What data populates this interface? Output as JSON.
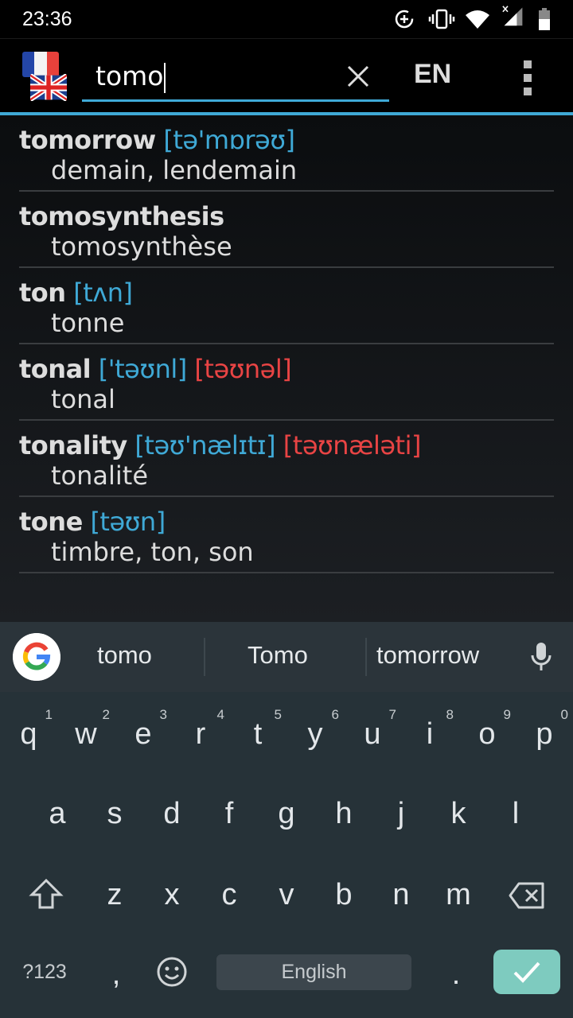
{
  "status_bar": {
    "time": "23:36",
    "icons": [
      "data-saver-icon",
      "vibrate-icon",
      "wifi-icon",
      "signal-no-data-icon",
      "battery-icon"
    ]
  },
  "app_bar": {
    "source_flag": "france-flag-icon",
    "target_flag": "uk-flag-icon",
    "search_value": "tomo",
    "clear_icon": "close-icon",
    "language_label": "EN",
    "menu_icon": "more-vert-icon",
    "accent_color": "#3fa9d6"
  },
  "results": [
    {
      "word": "tomorrow",
      "pron": "[tə'mɒrəʊ]",
      "pron_alt": "",
      "translation": "demain, lendemain"
    },
    {
      "word": "tomosynthesis",
      "pron": "",
      "pron_alt": "",
      "translation": "tomosynthèse"
    },
    {
      "word": "ton",
      "pron": "[tʌn]",
      "pron_alt": "",
      "translation": "tonne"
    },
    {
      "word": "tonal",
      "pron": "['təʊnl]",
      "pron_alt": "[təʊnəl]",
      "translation": "tonal"
    },
    {
      "word": "tonality",
      "pron": "[təʊ'nælɪtɪ]",
      "pron_alt": "[təʊnæləti]",
      "translation": "tonalité"
    },
    {
      "word": "tone",
      "pron": "[təʊn]",
      "pron_alt": "",
      "translation": "timbre, ton, son"
    }
  ],
  "colors": {
    "pron": "#3fa9d6",
    "pron_alt": "#e84444",
    "keyboard_bg": "#263238",
    "enter_key": "#7ecbbf"
  },
  "keyboard": {
    "suggestions": [
      "tomo",
      "Tomo",
      "tomorrow"
    ],
    "rows": [
      [
        [
          "q",
          "1"
        ],
        [
          "w",
          "2"
        ],
        [
          "e",
          "3"
        ],
        [
          "r",
          "4"
        ],
        [
          "t",
          "5"
        ],
        [
          "y",
          "6"
        ],
        [
          "u",
          "7"
        ],
        [
          "i",
          "8"
        ],
        [
          "o",
          "9"
        ],
        [
          "p",
          "0"
        ]
      ],
      [
        [
          "a",
          ""
        ],
        [
          "s",
          ""
        ],
        [
          "d",
          ""
        ],
        [
          "f",
          ""
        ],
        [
          "g",
          ""
        ],
        [
          "h",
          ""
        ],
        [
          "j",
          ""
        ],
        [
          "k",
          ""
        ],
        [
          "l",
          ""
        ]
      ],
      [
        [
          "z",
          ""
        ],
        [
          "x",
          ""
        ],
        [
          "c",
          ""
        ],
        [
          "v",
          ""
        ],
        [
          "b",
          ""
        ],
        [
          "n",
          ""
        ],
        [
          "m",
          ""
        ]
      ]
    ],
    "symbols_label": "?123",
    "comma": ",",
    "space_label": "English",
    "period": "."
  }
}
